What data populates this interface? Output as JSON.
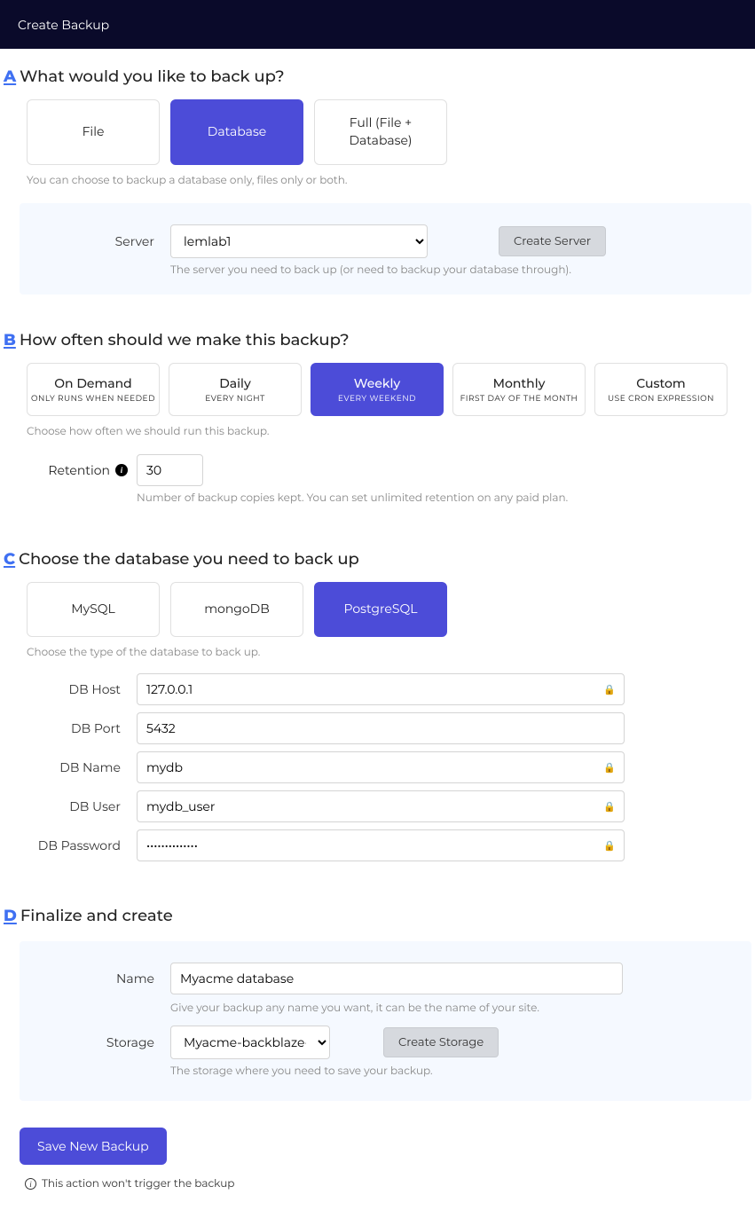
{
  "topbar": {
    "title": "Create Backup"
  },
  "sectionA": {
    "letter": "A",
    "title": "What would you like to back up?",
    "options": [
      "File",
      "Database",
      "Full (File + Database)"
    ],
    "selected": 1,
    "hint": "You can choose to backup a database only, files only or both.",
    "serverLabel": "Server",
    "serverValue": "lemlab1",
    "createServerLabel": "Create Server",
    "serverHelp": "The server you need to back up (or need to backup your database through)."
  },
  "sectionB": {
    "letter": "B",
    "title": "How often should we make this backup?",
    "freq": [
      {
        "title": "On Demand",
        "sub": "ONLY RUNS WHEN NEEDED"
      },
      {
        "title": "Daily",
        "sub": "EVERY NIGHT"
      },
      {
        "title": "Weekly",
        "sub": "EVERY WEEKEND"
      },
      {
        "title": "Monthly",
        "sub": "FIRST DAY OF THE MONTH"
      },
      {
        "title": "Custom",
        "sub": "USE CRON EXPRESSION"
      }
    ],
    "selected": 2,
    "hint": "Choose how often we should run this backup.",
    "retentionLabel": "Retention",
    "retentionValue": "30",
    "retentionHelp": "Number of backup copies kept. You can set unlimited retention on any paid plan."
  },
  "sectionC": {
    "letter": "C",
    "title": "Choose the database you need to back up",
    "engines": [
      "MySQL",
      "mongoDB",
      "PostgreSQL"
    ],
    "selected": 2,
    "hint": "Choose the type of the database to back up.",
    "fields": {
      "hostLabel": "DB Host",
      "hostValue": "127.0.0.1",
      "portLabel": "DB Port",
      "portValue": "5432",
      "nameLabel": "DB Name",
      "nameValue": "mydb",
      "userLabel": "DB User",
      "userValue": "mydb_user",
      "pwdLabel": "DB Password",
      "pwdValue": "••••••••••••••"
    }
  },
  "sectionD": {
    "letter": "D",
    "title": "Finalize and create",
    "nameLabel": "Name",
    "nameValue": "Myacme database",
    "nameHelp": "Give your backup any name you want, it can be the name of your site.",
    "storageLabel": "Storage",
    "storageValue": "Myacme-backblaze-bucket",
    "createStorageLabel": "Create Storage",
    "storageHelp": "The storage where you need to save your backup."
  },
  "actions": {
    "saveLabel": "Save New Backup",
    "note": "This action won't trigger the backup"
  }
}
